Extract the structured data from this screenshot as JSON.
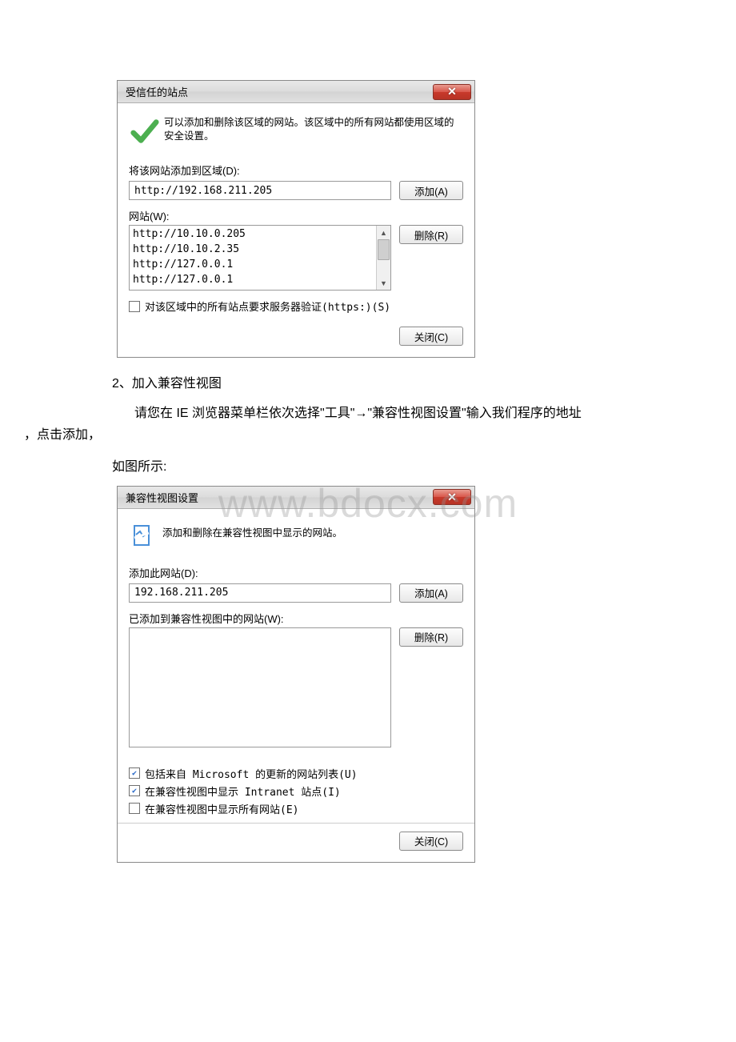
{
  "watermark": "www.bdocx.com",
  "dialog1": {
    "title": "受信任的站点",
    "description": "可以添加和删除该区域的网站。该区域中的所有网站都使用区域的安全设置。",
    "addLabel": "将该网站添加到区域(D):",
    "addValue": "http://192.168.211.205",
    "addButton": "添加(A)",
    "listLabel": "网站(W):",
    "listItems": [
      "http://10.10.0.205",
      "http://10.10.2.35",
      "http://127.0.0.1",
      "http://127.0.0.1"
    ],
    "removeButton": "删除(R)",
    "httpsCheckLabel": "对该区域中的所有站点要求服务器验证(https:)(S)",
    "httpsChecked": false,
    "closeButton": "关闭(C)"
  },
  "bodyText": {
    "step2": "2、加入兼容性视图",
    "para1a": "请您在 IE 浏览器菜单栏依次选择\"工具\"→\"兼容性视图设置\"输入我们程序的地址",
    "para1b": "，点击添加，",
    "para2": "如图所示:"
  },
  "dialog2": {
    "title": "兼容性视图设置",
    "description": "添加和删除在兼容性视图中显示的网站。",
    "addLabel": "添加此网站(D):",
    "addValue": "192.168.211.205",
    "addButton": "添加(A)",
    "listLabel": "已添加到兼容性视图中的网站(W):",
    "removeButton": "删除(R)",
    "check1": {
      "label": "包括来自 Microsoft 的更新的网站列表(U)",
      "checked": true
    },
    "check2": {
      "label": "在兼容性视图中显示 Intranet 站点(I)",
      "checked": true
    },
    "check3": {
      "label": "在兼容性视图中显示所有网站(E)",
      "checked": false
    },
    "closeButton": "关闭(C)"
  }
}
